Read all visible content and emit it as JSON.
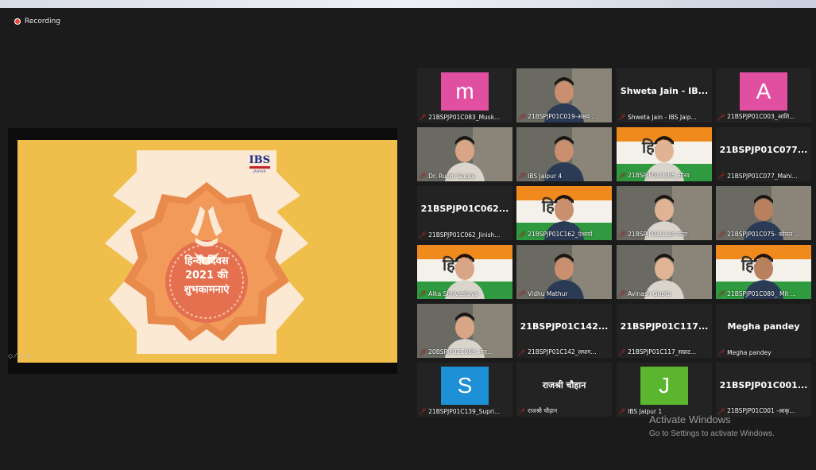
{
  "recording": {
    "label": "Recording"
  },
  "slide": {
    "logo_main": "IBS",
    "logo_sub": "JAIPUR",
    "line1": "हिन्दी दिवस",
    "line2": "2021 की",
    "line3": "शुभकामनाएं"
  },
  "tiles": [
    {
      "type": "avatar",
      "letter": "m",
      "color": "#e14fa1",
      "label": "21BSPJP01C083_Musk..."
    },
    {
      "type": "video",
      "label": "21BSPJP01C019-अक्षय ..."
    },
    {
      "type": "name",
      "name": "Shweta Jain - IB...",
      "label": "Shweta Jain - IBS Jaip..."
    },
    {
      "type": "avatar",
      "letter": "A",
      "color": "#e14fa1",
      "label": "21BSPJP01C003_आशि..."
    },
    {
      "type": "video",
      "label": "Dr. Ruchi Gupta"
    },
    {
      "type": "video",
      "label": "IBS Jaipur 4"
    },
    {
      "type": "video",
      "label": "21BSPJP01C185_सौरव"
    },
    {
      "type": "name",
      "name": "21BSPJP01C077...",
      "label": "21BSPJP01C077_Mahi..."
    },
    {
      "type": "name",
      "name": "21BSPJP01C062...",
      "label": "21BSPJP01C062_Jinish..."
    },
    {
      "type": "video",
      "label": "21BSPJP01C162_ऐश्वर्या"
    },
    {
      "type": "video",
      "label": "21BSPJP01C134-स्नेहा"
    },
    {
      "type": "video",
      "label": "21BSPJP01C075- कोमल ...",
      "active": true
    },
    {
      "type": "video",
      "label": "Alka Shrivastava"
    },
    {
      "type": "video",
      "label": "Vidhu Mathur"
    },
    {
      "type": "video",
      "label": "Avinash Gupta"
    },
    {
      "type": "video",
      "label": "21BSPJP01C080_ Mit ..."
    },
    {
      "type": "video",
      "label": "20BSPJP01C089_मोह..."
    },
    {
      "type": "name",
      "name": "21BSPJP01C142...",
      "label": "21BSPJP01C142_लधाग..."
    },
    {
      "type": "name",
      "name": "21BSPJP01C117...",
      "label": "21BSPJP01C117_सम्राट..."
    },
    {
      "type": "name",
      "name": "Megha pandey",
      "label": "Megha pandey"
    },
    {
      "type": "avatar",
      "letter": "S",
      "color": "#1e90d6",
      "label": "21BSPJP01C139_Supri..."
    },
    {
      "type": "name",
      "name": "राजश्री चौहान",
      "label": "राजश्री चौहान"
    },
    {
      "type": "avatar",
      "letter": "J",
      "color": "#5bb52e",
      "label": "IBS Jaipur 1"
    },
    {
      "type": "name",
      "name": "21BSPJP01C001...",
      "label": "21BSPJP01C001 -आकृ..."
    }
  ],
  "watermark": {
    "line1": "Activate Windows",
    "line2": "Go to Settings to activate Windows."
  }
}
